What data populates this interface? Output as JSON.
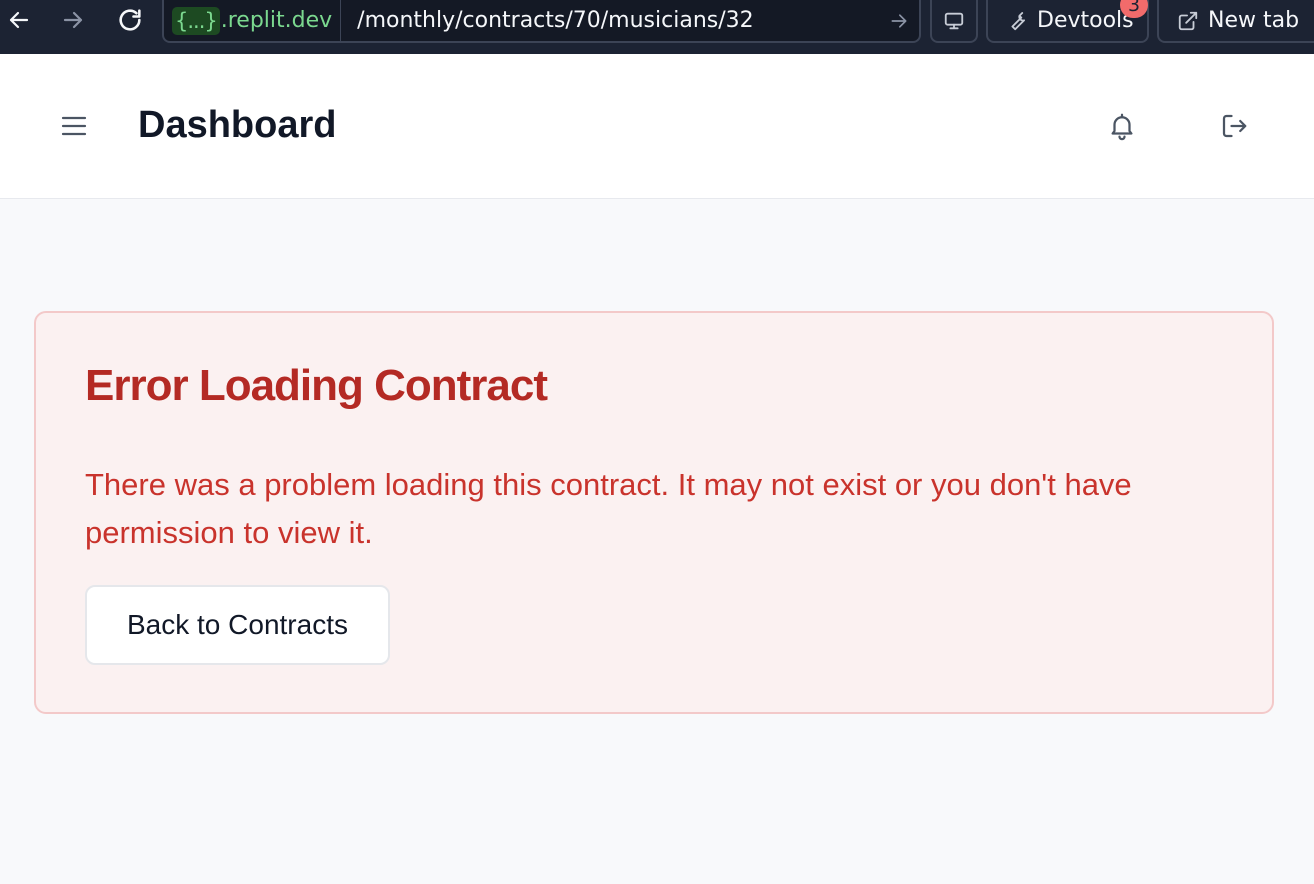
{
  "browser": {
    "url_badge": "{...}",
    "url_host": ".replit.dev",
    "url_path": "/monthly/contracts/70/musicians/32",
    "devtools_label": "Devtools",
    "devtools_badge": "3",
    "new_tab_label": "New tab",
    "icons": [
      "back-arrow-icon",
      "forward-arrow-icon",
      "reload-icon",
      "go-arrow-icon",
      "monitor-icon",
      "wrench-icon",
      "external-link-icon"
    ]
  },
  "header": {
    "title": "Dashboard",
    "icons": [
      "hamburger-menu-icon",
      "bell-icon",
      "logout-icon"
    ]
  },
  "error": {
    "title": "Error Loading Contract",
    "message": "There was a problem loading this contract. It may not exist or you don't have permission to view it.",
    "back_button_label": "Back to Contracts"
  },
  "colors": {
    "browser_bar": "#1c2333",
    "error_text": "#b42a24",
    "error_background": "#fbf1f1",
    "error_border": "#f3c9c9",
    "page_background": "#f8f9fb"
  }
}
